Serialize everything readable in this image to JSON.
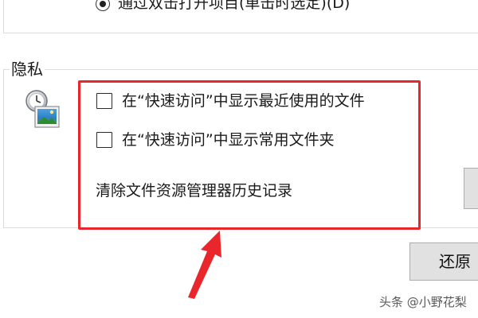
{
  "top_option": {
    "radio_label": "通过双击打开项目(单击时选定)(D)"
  },
  "privacy": {
    "legend": "隐私",
    "checkbox_recent_files": "在“快速访问”中显示最近使用的文件",
    "checkbox_frequent_folders": "在“快速访问”中显示常用文件夹",
    "clear_history_label": "清除文件资源管理器历史记录"
  },
  "buttons": {
    "restore_label": "还原"
  },
  "watermark": {
    "text": "头条 @小野花梨"
  },
  "colors": {
    "highlight": "#e8262c",
    "arrow": "#e8262c"
  }
}
